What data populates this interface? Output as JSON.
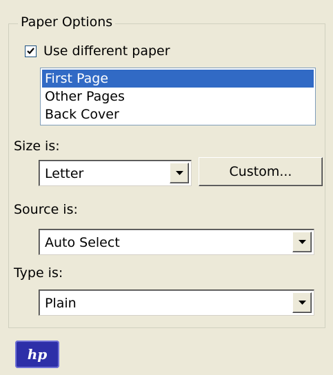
{
  "paper_options": {
    "title": "Paper Options",
    "use_different_paper": {
      "label": "Use different paper",
      "checked": true
    },
    "pages": {
      "items": [
        "First Page",
        "Other Pages",
        "Back Cover"
      ],
      "selected": "First Page"
    },
    "size": {
      "label": "Size is:",
      "value": "Letter",
      "custom_button": "Custom..."
    },
    "source": {
      "label": "Source is:",
      "value": "Auto Select"
    },
    "type": {
      "label": "Type is:",
      "value": "Plain"
    }
  },
  "brand": {
    "logo_text": "hp",
    "logo_color": "#2d2fa8"
  },
  "colors": {
    "selection": "#316ac5",
    "background": "#ece9d8"
  }
}
